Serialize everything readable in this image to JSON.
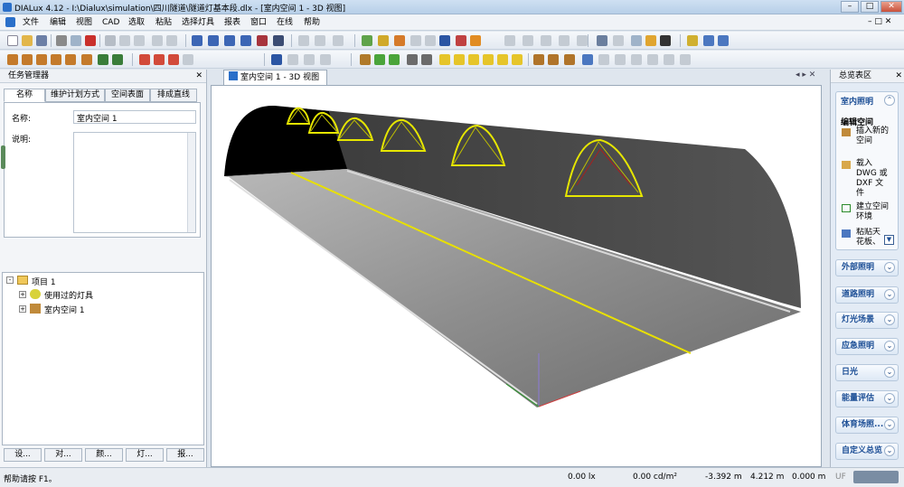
{
  "window": {
    "title": "DIALux 4.12 - I:\\Dialux\\simulation\\四川隧道\\隧道灯基本段.dlx - [室内空间 1 - 3D 视图]",
    "minimize": "–",
    "maximize": "□",
    "close": "✕"
  },
  "menu": [
    "文件",
    "编辑",
    "视图",
    "CAD",
    "选取",
    "粘贴",
    "选择灯具",
    "报表",
    "窗口",
    "在线",
    "帮助"
  ],
  "left_panel": {
    "title": "任务管理器",
    "tabs": [
      "名称",
      "维护计划方式",
      "空间表面",
      "排成直线"
    ],
    "name_label": "名称:",
    "name_value": "室内空间 1",
    "desc_label": "说明:",
    "desc_value": "",
    "tree": {
      "root": "项目 1",
      "children": [
        "使用过的灯具",
        "室内空间 1"
      ]
    },
    "bottom_tabs": [
      "设...",
      "对...",
      "颜...",
      "灯...",
      "报..."
    ]
  },
  "view": {
    "tab_title": "室内空间 1 - 3D 视图"
  },
  "right_panel": {
    "title": "总览表区",
    "expanded": {
      "header": "室内照明",
      "group": "编辑空间",
      "items": [
        "插入新的空间",
        "载入 DWG 或 DXF 文件",
        "建立空间环境",
        "粘贴天花板、"
      ]
    },
    "sections": [
      "外部照明",
      "道路照明",
      "灯光场景",
      "应急照明",
      "日光",
      "能量评估",
      "体育场照...",
      "自定义总览"
    ]
  },
  "status": {
    "help": "帮助请按 F1。",
    "illuminance": "0.00 lx",
    "luminance": "0.00 cd/m²",
    "x": "-3.392 m",
    "y": "4.212 m",
    "z": "0.000 m",
    "uf": "UF"
  },
  "colors": {
    "accent": "#1d4f96",
    "road_line": "#e8e000",
    "luminaire": "#e6e600"
  }
}
